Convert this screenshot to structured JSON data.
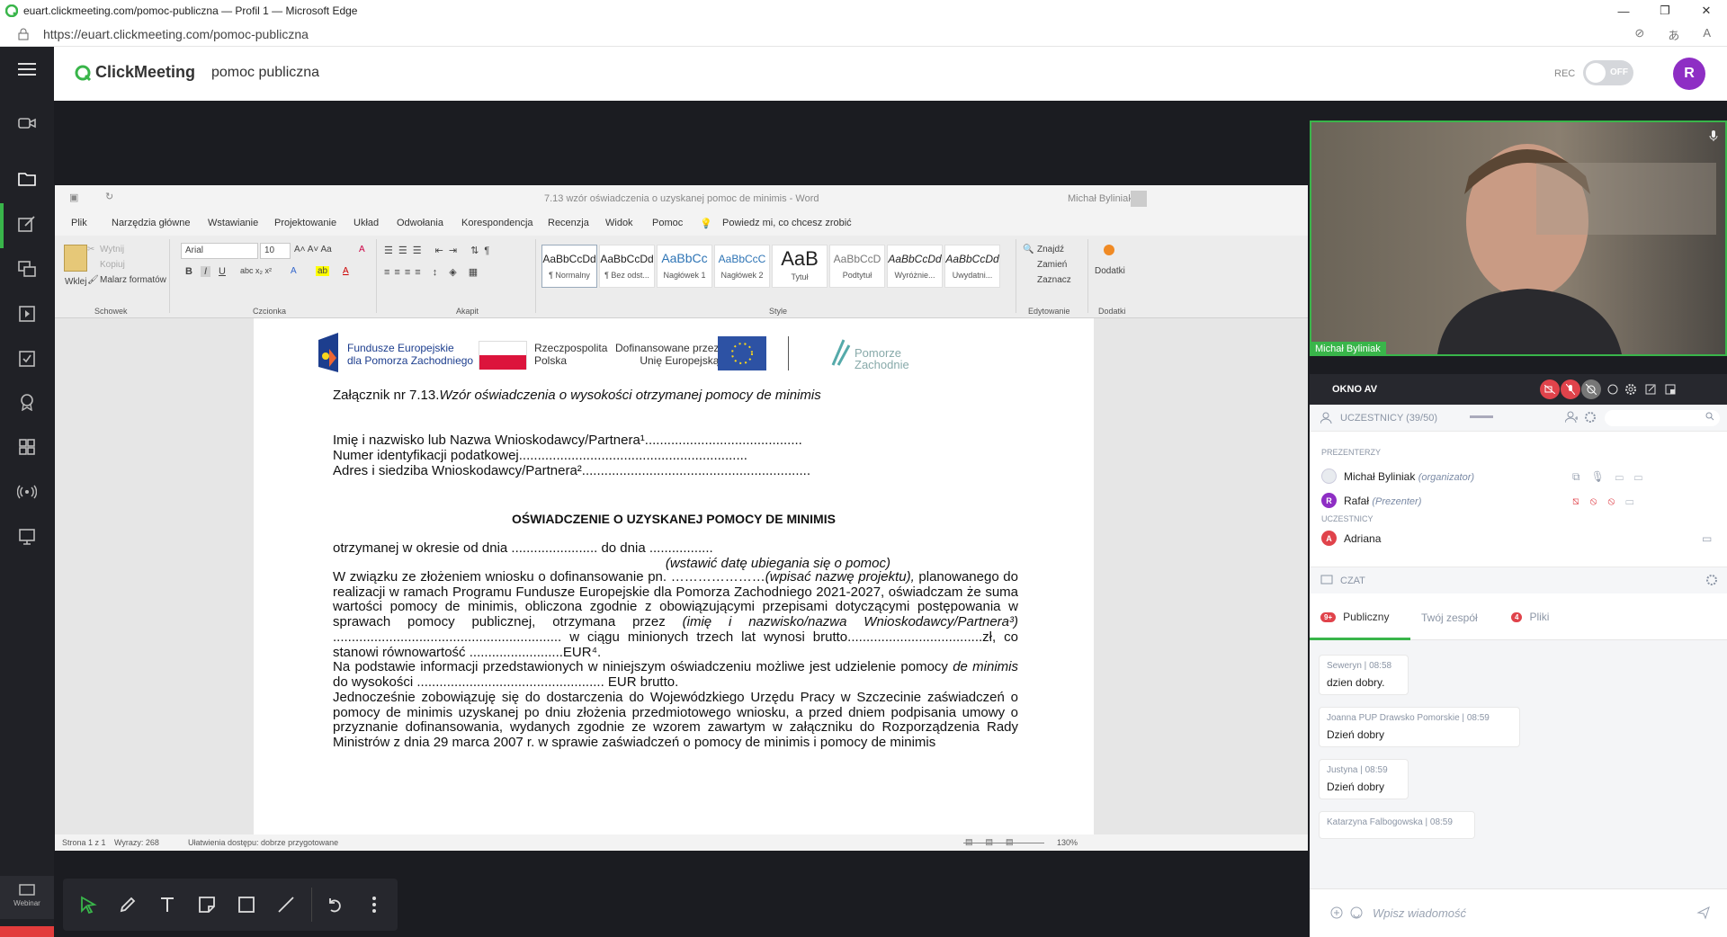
{
  "browser": {
    "title": "euart.clickmeeting.com/pomoc-publiczna — Profil 1 — Microsoft Edge",
    "url": "https://euart.clickmeeting.com/pomoc-publiczna"
  },
  "app": {
    "brand": "ClickMeeting",
    "room_name": "pomoc publiczna",
    "rec_label": "REC",
    "rec_toggle": "OFF",
    "user_initial": "R",
    "webinar_label": "Webinar"
  },
  "word": {
    "title": "7.13 wzór oświadczenia o uzyskanej pomoc de minimis - Word",
    "user": "Michał Byliniak",
    "tabs": [
      "Plik",
      "Narzędzia główne",
      "Wstawianie",
      "Projektowanie",
      "Układ",
      "Odwołania",
      "Korespondencja",
      "Recenzja",
      "Widok",
      "Pomoc"
    ],
    "tell_me": "Powiedz mi, co chcesz zrobić",
    "clipboard": {
      "paste": "Wklej",
      "cut": "Wytnij",
      "copy": "Kopiuj",
      "painter": "Malarz formatów",
      "group": "Schowek"
    },
    "font": {
      "name": "Arial",
      "size": "10",
      "group": "Czcionka"
    },
    "paragraph_group": "Akapit",
    "styles_group": "Style",
    "styles": [
      {
        "preview": "AaBbCcDd",
        "name": "¶ Normalny"
      },
      {
        "preview": "AaBbCcDd",
        "name": "¶ Bez odst..."
      },
      {
        "preview": "AaBbCc",
        "name": "Nagłówek 1"
      },
      {
        "preview": "AaBbCcC",
        "name": "Nagłówek 2"
      },
      {
        "preview": "AaB",
        "name": "Tytuł"
      },
      {
        "preview": "AaBbCcD",
        "name": "Podtytuł"
      },
      {
        "preview": "AaBbCcDd",
        "name": "Wyróżnie..."
      },
      {
        "preview": "AaBbCcDd",
        "name": "Uwydatni..."
      }
    ],
    "editing": {
      "find": "Znajdź",
      "replace": "Zamień",
      "select": "Zaznacz",
      "group": "Edytowanie"
    },
    "addins": {
      "label": "Dodatki",
      "group": "Dodatki"
    },
    "status": {
      "page": "Strona 1 z 1",
      "words": "Wyrazy: 268",
      "accessibility": "Ułatwienia dostępu: dobrze przygotowane",
      "zoom": "130%"
    }
  },
  "document": {
    "logos": {
      "fe": "Fundusze Europejskie\ndla Pomorza Zachodniego",
      "rp": "Rzeczpospolita\nPolska",
      "ue": "Dofinansowane przez\nUnię Europejską",
      "pz": "Pomorze\nZachodnie"
    },
    "annex_prefix": "Załącznik nr 7.13.",
    "annex_title": "Wzór oświadczenia o wysokości otrzymanej pomocy de minimis",
    "field1": "Imię i nazwisko lub Nazwa Wnioskodawcy/Partnera¹..........................................",
    "field2": "Numer identyfikacji podatkowej.............................................................",
    "field3": "Adres i siedziba Wnioskodawcy/Partnera².............................................................",
    "heading": "OŚWIADCZENIE O UZYSKANEJ POMOCY DE MINIMIS",
    "line_period": "otrzymanej w okresie od dnia ....................... do dnia .................",
    "line_hint": "(wstawić datę ubiegania się o pomoc)",
    "para1_a": "W związku ze złożeniem wniosku o dofinansowanie pn. …………………",
    "para1_b": "(wpisać nazwę projektu),",
    "para1_c": " planowanego do realizacji w ramach Programu Fundusze Europejskie dla Pomorza Zachodniego 2021-2027, oświadczam że suma wartości pomocy de minimis, obliczona zgodnie z obowiązującymi przepisami dotyczącymi postępowania w sprawach pomocy publicznej, otrzymana przez ",
    "para1_d": "(imię i nazwisko/nazwa Wnioskodawcy/Partnera³)",
    "para1_e": " ............................................................. w ciągu minionych trzech lat wynosi brutto....................................zł, co stanowi równowartość .........................EUR⁴.",
    "para2_a": "Na podstawie informacji przedstawionych w niniejszym oświadczeniu możliwe jest udzielenie pomocy ",
    "para2_b": "de minimis",
    "para2_c": " do wysokości .................................................. EUR brutto.",
    "para3": "Jednocześnie zobowiązuję się do dostarczenia do Wojewódzkiego Urzędu Pracy w Szczecinie zaświadczeń o pomocy de minimis uzyskanej po dniu złożenia przedmiotowego wniosku, a przed dniem podpisania umowy o przyznanie dofinansowania, wydanych zgodnie ze wzorem zawartym w załączniku do Rozporządzenia Rady Ministrów z dnia 29 marca 2007 r. w sprawie zaświadczeń o pomocy de minimis i pomocy de minimis"
  },
  "panel": {
    "video_name": "Michał Byliniak",
    "okno_label": "OKNO AV",
    "participants_header": "UCZESTNICY (39/50)",
    "presenters_label": "PREZENTERZY",
    "participants_label": "UCZESTNICY",
    "presenters": [
      {
        "name": "Michał Byliniak",
        "role": "(organizator)",
        "initial": ""
      },
      {
        "name": "Rafał",
        "role": "(Prezenter)",
        "initial": "R"
      }
    ],
    "participants": [
      {
        "name": "Adriana",
        "initial": "A"
      }
    ],
    "chat_label": "CZAT",
    "chat_tabs": [
      {
        "label": "Publiczny",
        "badge": "9+"
      },
      {
        "label": "Twój zespół",
        "badge": ""
      },
      {
        "label": "Pliki",
        "badge": "4"
      }
    ],
    "messages": [
      {
        "author": "Seweryn",
        "time": "08:58",
        "text": "dzien dobry."
      },
      {
        "author": "Joanna PUP Drawsko Pomorskie",
        "time": "08:59",
        "text": "Dzień dobry"
      },
      {
        "author": "Justyna",
        "time": "08:59",
        "text": "Dzień dobry"
      },
      {
        "author": "Katarzyna Falbogowska",
        "time": "08:59",
        "text": ""
      }
    ],
    "chat_placeholder": "Wpisz wiadomość"
  },
  "colors": {
    "accent": "#39b54a",
    "power": "#e33c3c",
    "avatar": "#8e2ec4",
    "muted_red": "#e0434b"
  }
}
